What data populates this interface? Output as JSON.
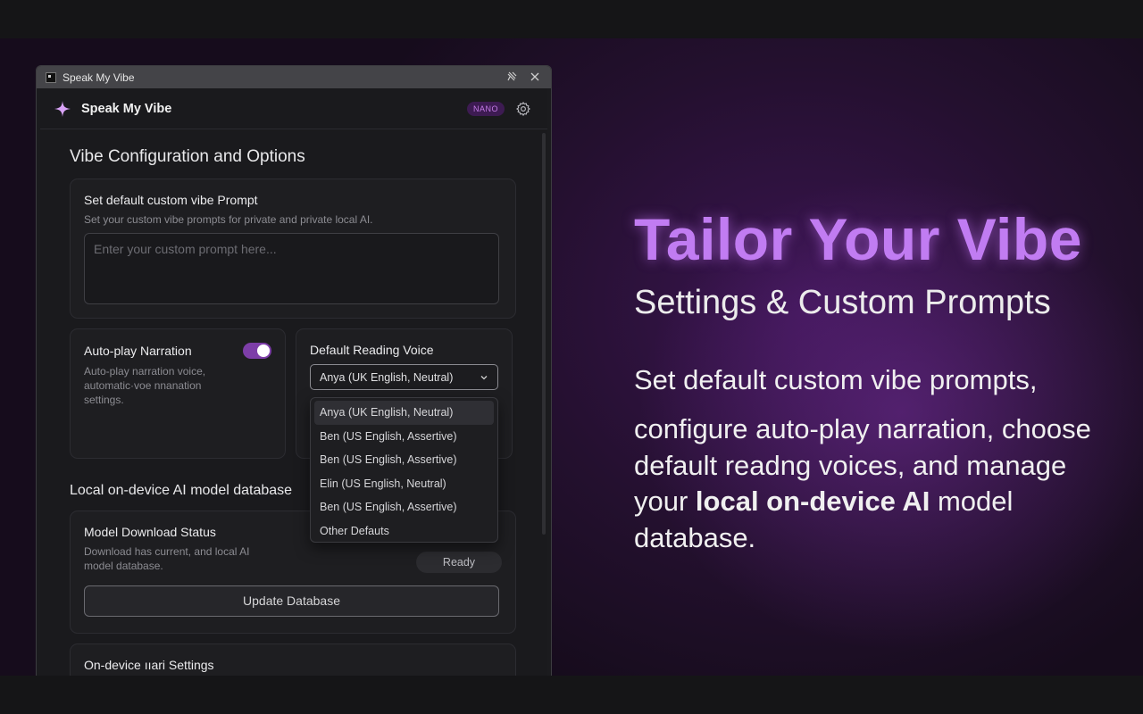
{
  "window": {
    "title": "Speak My Vibe",
    "app_name": "Speak My Vibe",
    "badge": "NANO"
  },
  "settings": {
    "section_title": "Vibe Configuration and Options",
    "prompt_card": {
      "title": "Set default custom vibe Prompt",
      "desc": "Set your custom vibe prompts for private and private local AI.",
      "placeholder": "Enter your custom prompt here..."
    },
    "autoplay_card": {
      "title": "Auto-play Narration",
      "desc": "Auto-play narration voice, automatic·voe nnanation settings.",
      "enabled": true
    },
    "voice_card": {
      "title": "Default Reading Voice",
      "selected": "Anya (UK English, Neutral)",
      "options": [
        "Anya (UK English, Neutral)",
        "Ben (US English, Assertive)",
        "Ben (US English, Assertive)",
        "Elin (US English, Neutral)",
        "Ben (US English, Assertive)",
        "Other Defauts"
      ]
    },
    "model_section_title": "Local on-device AI model database",
    "model_card": {
      "title": "Model Download Status",
      "desc": "Download has current, and local AI model database.",
      "status": "Ready",
      "update_label": "Update Database"
    },
    "ondevice_card": {
      "title": "On-device ııari Settings"
    }
  },
  "promo": {
    "headline": "Tailor Your Vibe",
    "subhead": "Settings & Custom Prompts",
    "line1": "Set default custom vibe prompts,",
    "line2_pre": "configure auto-play narration, choose default readng voices, and manage your ",
    "line2_bold": "local on-device AI",
    "line2_post": " model database.",
    "accent_color": "#c17cf2"
  }
}
